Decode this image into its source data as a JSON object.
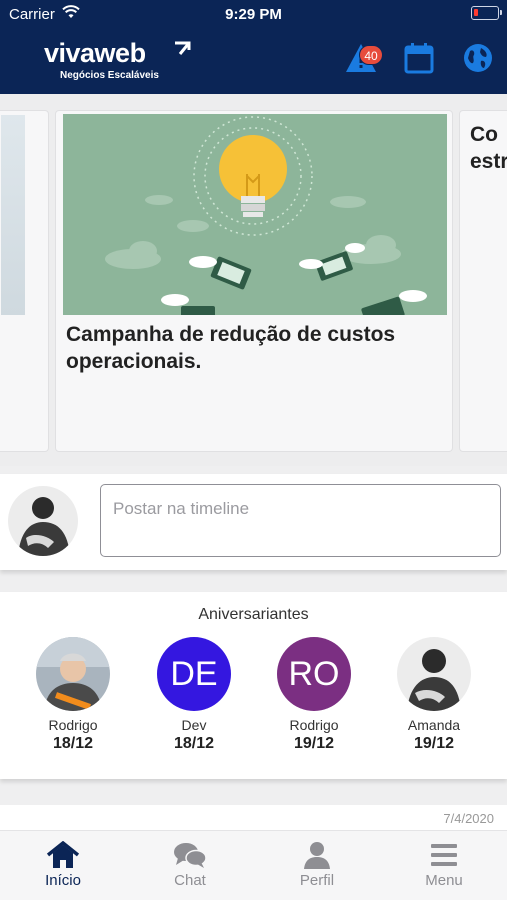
{
  "status_bar": {
    "carrier": "Carrier",
    "time": "9:29 PM"
  },
  "header": {
    "logo_text": "vivaweb",
    "logo_tagline": "Negócios Escaláveis",
    "alert_badge_count": "40",
    "icons": [
      "alert-icon",
      "calendar-icon",
      "globe-icon"
    ]
  },
  "carousel": {
    "main_card_title": "Campanha de redução de custos operacionais.",
    "next_card_title": "Co\nestr"
  },
  "post_box": {
    "placeholder": "Postar na timeline"
  },
  "birthdays": {
    "title": "Aniversariantes",
    "people": [
      {
        "name": "Rodrigo",
        "date": "18/12",
        "initials": ""
      },
      {
        "name": "Dev",
        "date": "18/12",
        "initials": "DE",
        "color": "#3417e0"
      },
      {
        "name": "Rodrigo",
        "date": "19/12",
        "initials": "RO",
        "color": "#7b2f82"
      },
      {
        "name": "Amanda",
        "date": "19/12",
        "initials": ""
      }
    ]
  },
  "next_post": {
    "date": "7/4/2020"
  },
  "tabbar": {
    "active_color": "#0b2556",
    "items": [
      {
        "label": "Início",
        "icon": "home-icon"
      },
      {
        "label": "Chat",
        "icon": "chat-icon"
      },
      {
        "label": "Perfil",
        "icon": "profile-icon"
      },
      {
        "label": "Menu",
        "icon": "menu-icon"
      }
    ]
  },
  "colors": {
    "header_bg": "#0b2556",
    "accent": "#1a7be0",
    "badge": "#e74c3c"
  }
}
